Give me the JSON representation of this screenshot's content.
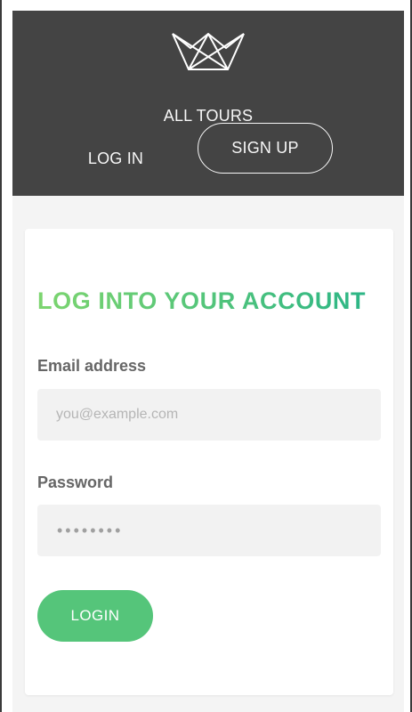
{
  "header": {
    "logo_icon": "crown-icon",
    "nav": {
      "all_tours": "ALL TOURS",
      "log_in": "LOG IN",
      "sign_up": "SIGN UP"
    }
  },
  "login_form": {
    "title": "LOG INTO YOUR ACCOUNT",
    "email": {
      "label": "Email address",
      "placeholder": "you@example.com",
      "value": ""
    },
    "password": {
      "label": "Password",
      "value_masked": "••••••••"
    },
    "submit_label": "LOGIN"
  },
  "colors": {
    "header_bg": "#444444",
    "accent_green": "#55c57a",
    "title_gradient_start": "#7dd56f",
    "title_gradient_end": "#28b487",
    "input_bg": "#f2f2f2",
    "page_bg": "#f4f4f4"
  }
}
